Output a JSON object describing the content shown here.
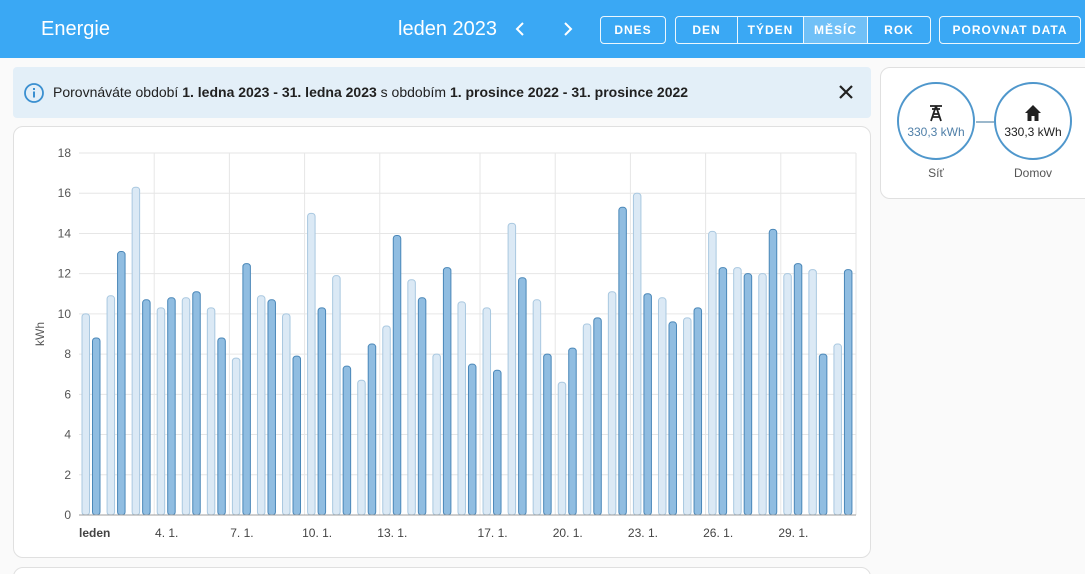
{
  "header": {
    "title": "Energie",
    "period": "leden 2023",
    "today_label": "DNES",
    "modes": [
      "DEN",
      "TÝDEN",
      "MĚSÍC",
      "ROK"
    ],
    "active_mode": "MĚSÍC",
    "compare_label": "POROVNAT DATA"
  },
  "banner": {
    "prefix": "Porovnáváte období ",
    "range_current": "1. ledna 2023 - 31. ledna 2023",
    "middle": " s obdobím ",
    "range_previous": "1. prosince 2022 - 31. prosince 2022"
  },
  "flow": {
    "grid": {
      "value": "330,3 kWh",
      "label": "Síť"
    },
    "home": {
      "value": "330,3 kWh",
      "label": "Domov"
    }
  },
  "colors": {
    "header": "#3aa8f4",
    "current_fill": "#90bde1",
    "current_stroke": "#4a87b8",
    "previous_fill": "#dbe9f5",
    "previous_stroke": "#a9c8e0"
  },
  "chart_data": {
    "type": "bar",
    "ylabel": "kWh",
    "ylim": [
      0,
      18
    ],
    "yticks": [
      0,
      2,
      4,
      6,
      8,
      10,
      12,
      14,
      16,
      18
    ],
    "x_ticks": [
      {
        "day": 1,
        "label": "leden"
      },
      {
        "day": 4,
        "label": "4. 1."
      },
      {
        "day": 7,
        "label": "7. 1."
      },
      {
        "day": 10,
        "label": "10. 1."
      },
      {
        "day": 13,
        "label": "13. 1."
      },
      {
        "day": 17,
        "label": "17. 1."
      },
      {
        "day": 20,
        "label": "20. 1."
      },
      {
        "day": 23,
        "label": "23. 1."
      },
      {
        "day": 26,
        "label": "26. 1."
      },
      {
        "day": 29,
        "label": "29. 1."
      }
    ],
    "days": 31,
    "series": [
      {
        "key": "previous",
        "values": [
          10.0,
          10.9,
          16.3,
          10.3,
          10.8,
          10.3,
          7.8,
          10.9,
          10.0,
          15.0,
          11.9,
          6.7,
          9.4,
          11.7,
          8.0,
          10.6,
          10.3,
          14.5,
          10.7,
          6.6,
          9.5,
          11.1,
          16.0,
          10.8,
          9.8,
          14.1,
          12.3,
          12.0,
          12.0,
          12.2,
          8.5
        ]
      },
      {
        "key": "current",
        "values": [
          8.8,
          13.1,
          10.7,
          10.8,
          11.1,
          8.8,
          12.5,
          10.7,
          7.9,
          10.3,
          7.4,
          8.5,
          13.9,
          10.8,
          12.3,
          7.5,
          7.2,
          11.8,
          8.0,
          8.3,
          9.8,
          15.3,
          11.0,
          9.6,
          10.3,
          12.3,
          12.0,
          14.2,
          12.5,
          8.0,
          12.2
        ]
      }
    ]
  }
}
